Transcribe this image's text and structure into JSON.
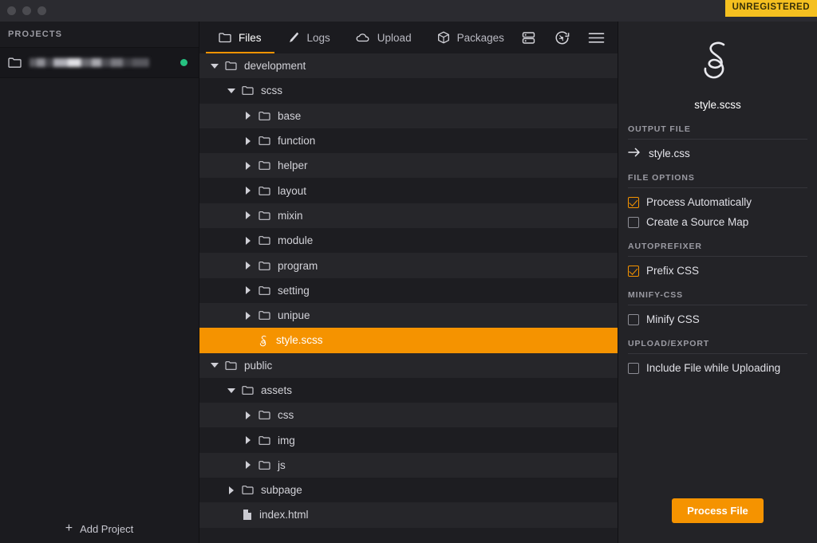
{
  "window": {
    "traffic_lights": [
      "close",
      "minimize",
      "zoom"
    ],
    "badge": "UNREGISTERED"
  },
  "colors": {
    "accent": "#f59300",
    "badge_bg": "#f5c020",
    "status_online": "#26c281",
    "panel_bg": "#232327",
    "tree_bg": "#1e1e22",
    "sidebar_bg": "#1b1b1f",
    "titlebar_bg": "#2b2b30"
  },
  "sidebar": {
    "header": "PROJECTS",
    "project": {
      "name": "",
      "name_redacted": true,
      "icon": "folder-icon",
      "status": "online"
    },
    "add_project_label": "Add Project"
  },
  "tabs": [
    {
      "label": "Files",
      "icon": "folder-icon",
      "active": true
    },
    {
      "label": "Logs",
      "icon": "pen-icon",
      "active": false
    },
    {
      "label": "Upload",
      "icon": "cloud-icon",
      "active": false
    },
    {
      "label": "Packages",
      "icon": "package-icon",
      "active": false
    }
  ],
  "toolbar_icons": [
    {
      "name": "server-stack-icon"
    },
    {
      "name": "refresh-dial-icon"
    },
    {
      "name": "hamburger-menu-icon"
    }
  ],
  "tree": [
    {
      "label": "development",
      "depth": 0,
      "type": "folder",
      "twisty": "down",
      "selected": false
    },
    {
      "label": "scss",
      "depth": 1,
      "type": "folder",
      "twisty": "down",
      "selected": false
    },
    {
      "label": "base",
      "depth": 2,
      "type": "folder",
      "twisty": "right",
      "selected": false
    },
    {
      "label": "function",
      "depth": 2,
      "type": "folder",
      "twisty": "right",
      "selected": false
    },
    {
      "label": "helper",
      "depth": 2,
      "type": "folder",
      "twisty": "right",
      "selected": false
    },
    {
      "label": "layout",
      "depth": 2,
      "type": "folder",
      "twisty": "right",
      "selected": false
    },
    {
      "label": "mixin",
      "depth": 2,
      "type": "folder",
      "twisty": "right",
      "selected": false
    },
    {
      "label": "module",
      "depth": 2,
      "type": "folder",
      "twisty": "right",
      "selected": false
    },
    {
      "label": "program",
      "depth": 2,
      "type": "folder",
      "twisty": "right",
      "selected": false
    },
    {
      "label": "setting",
      "depth": 2,
      "type": "folder",
      "twisty": "right",
      "selected": false
    },
    {
      "label": "unipue",
      "depth": 2,
      "type": "folder",
      "twisty": "right",
      "selected": false
    },
    {
      "label": "style.scss",
      "depth": 2,
      "type": "sass",
      "twisty": "none",
      "selected": true
    },
    {
      "label": "public",
      "depth": 0,
      "type": "folder",
      "twisty": "down",
      "selected": false
    },
    {
      "label": "assets",
      "depth": 1,
      "type": "folder",
      "twisty": "down",
      "selected": false
    },
    {
      "label": "css",
      "depth": 2,
      "type": "folder",
      "twisty": "right",
      "selected": false
    },
    {
      "label": "img",
      "depth": 2,
      "type": "folder",
      "twisty": "right",
      "selected": false
    },
    {
      "label": "js",
      "depth": 2,
      "type": "folder",
      "twisty": "right",
      "selected": false
    },
    {
      "label": "subpage",
      "depth": 1,
      "type": "folder",
      "twisty": "right",
      "selected": false
    },
    {
      "label": "index.html",
      "depth": 1,
      "type": "file",
      "twisty": "none",
      "selected": false
    }
  ],
  "inspector": {
    "file_icon": "sass-logo-icon",
    "filename": "style.scss",
    "sections": {
      "output_file": {
        "label": "OUTPUT FILE",
        "value": "style.css",
        "icon": "arrow-right-icon"
      },
      "file_options": {
        "label": "FILE OPTIONS",
        "options": [
          {
            "label": "Process Automatically",
            "checked": true
          },
          {
            "label": "Create a Source Map",
            "checked": false
          }
        ]
      },
      "autoprefixer": {
        "label": "AUTOPREFIXER",
        "options": [
          {
            "label": "Prefix CSS",
            "checked": true
          }
        ]
      },
      "minify_css": {
        "label": "MINIFY-CSS",
        "options": [
          {
            "label": "Minify CSS",
            "checked": false
          }
        ]
      },
      "upload_export": {
        "label": "UPLOAD/EXPORT",
        "options": [
          {
            "label": "Include File while Uploading",
            "checked": false
          }
        ]
      }
    },
    "process_button": "Process File"
  }
}
